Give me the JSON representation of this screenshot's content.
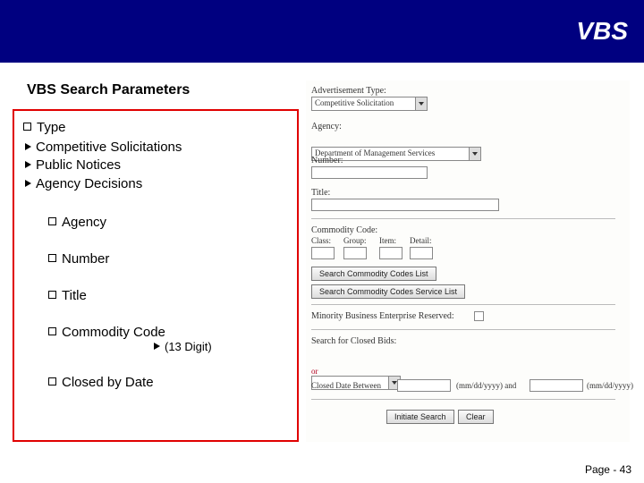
{
  "titlebar": "VBS",
  "subtitle": "VBS Search Parameters",
  "left": {
    "type": "Type",
    "type_items": {
      "a": "Competitive Solicitations",
      "b": "Public Notices",
      "c": "Agency Decisions"
    },
    "agency": "Agency",
    "number": "Number",
    "title": "Title",
    "commodity": "Commodity Code",
    "commodity_sub": "(13 Digit)",
    "closed": "Closed by Date"
  },
  "form": {
    "adv_type_label": "Advertisement Type:",
    "adv_type_value": "Competitive Solicitation",
    "agency_label": "Agency:",
    "agency_value": "Department of Management Services",
    "number_label": "Number:",
    "title_label": "Title:",
    "cc_label": "Commodity Code:",
    "cc_cols": {
      "class": "Class:",
      "group": "Group:",
      "item": "Item:",
      "detail": "Detail:"
    },
    "btn_search_cc": "Search Commodity Codes List",
    "btn_search_cc_svc": "Search Commodity Codes Service List",
    "mbe_label": "Minority Business Enterprise Reserved:",
    "closed_label": "Search for Closed Bids:",
    "or": "or",
    "cdb_label": "Closed Date Between",
    "date_hint1": "(mm/dd/yyyy) and",
    "date_hint2": "(mm/dd/yyyy)",
    "btn_go": "Initiate Search",
    "btn_clear": "Clear"
  },
  "footer": "Page - 43"
}
